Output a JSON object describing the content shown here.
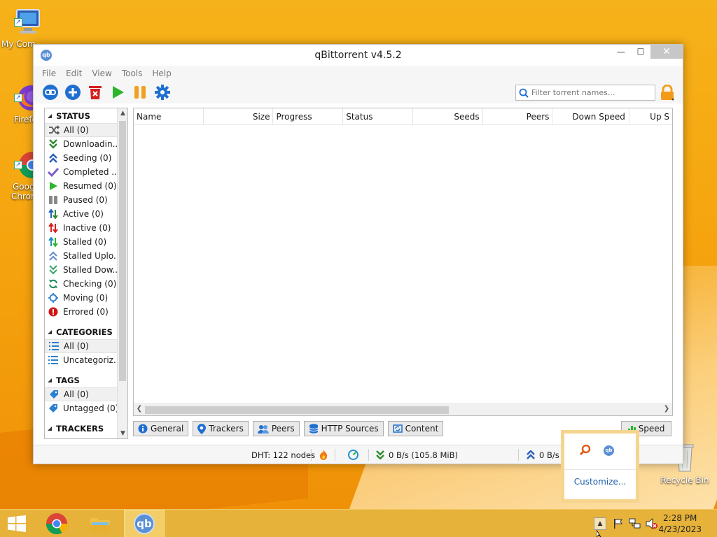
{
  "desktop": {
    "icons": [
      {
        "label": "My Com"
      },
      {
        "label": "Firefo"
      },
      {
        "label": "Goog"
      },
      {
        "label": "Chron"
      },
      {
        "label": "Recycle Bin"
      }
    ]
  },
  "window": {
    "title": "qBittorrent v4.5.2",
    "app_icon_text": "qb",
    "controls": {
      "minimize": "—",
      "maximize": "☐",
      "close": "✕"
    }
  },
  "menu": [
    "File",
    "Edit",
    "View",
    "Tools",
    "Help"
  ],
  "toolbar": {
    "search_placeholder": "Filter torrent names..."
  },
  "sidebar": {
    "status_header": "STATUS",
    "status_items": [
      {
        "label": "All (0)",
        "icon": "shuffle-icon",
        "color": "#555555"
      },
      {
        "label": "Downloadin...",
        "icon": "double-chevron-down-icon",
        "color": "#2e8b2e"
      },
      {
        "label": "Seeding (0)",
        "icon": "double-chevron-up-icon",
        "color": "#2a5fbf"
      },
      {
        "label": "Completed ...",
        "icon": "checkmark-icon",
        "color": "#7b5fc9"
      },
      {
        "label": "Resumed (0)",
        "icon": "play-icon",
        "color": "#2db52d"
      },
      {
        "label": "Paused (0)",
        "icon": "pause-icon",
        "color": "#888888"
      },
      {
        "label": "Active (0)",
        "icon": "up-down-arrows-icon",
        "color": "#2e8b2e"
      },
      {
        "label": "Inactive (0)",
        "icon": "up-down-arrows-red-icon",
        "color": "#d62020"
      },
      {
        "label": "Stalled (0)",
        "icon": "up-down-arrows-blue-icon",
        "color": "#1f8fbf"
      },
      {
        "label": "Stalled Uplo...",
        "icon": "double-chevron-up-light-icon",
        "color": "#6a8fd0"
      },
      {
        "label": "Stalled Dow...",
        "icon": "double-chevron-down-light-icon",
        "color": "#3fa86a"
      },
      {
        "label": "Checking (0)",
        "icon": "refresh-icon",
        "color": "#1a8a5a"
      },
      {
        "label": "Moving (0)",
        "icon": "move-target-icon",
        "color": "#2a7fd0"
      },
      {
        "label": "Errored (0)",
        "icon": "error-icon",
        "color": "#d41111"
      }
    ],
    "categories_header": "CATEGORIES",
    "category_items": [
      {
        "label": "All (0)"
      },
      {
        "label": "Uncategoriz..."
      }
    ],
    "tags_header": "TAGS",
    "tag_items": [
      {
        "label": "All (0)"
      },
      {
        "label": "Untagged (0)"
      }
    ],
    "trackers_header": "TRACKERS"
  },
  "table": {
    "columns": [
      "Name",
      "Size",
      "Progress",
      "Status",
      "Seeds",
      "Peers",
      "Down Speed",
      "Up S"
    ]
  },
  "tabs": [
    "General",
    "Trackers",
    "Peers",
    "HTTP Sources",
    "Content"
  ],
  "speed_button": "Speed",
  "statusbar": {
    "dht": "DHT: 122 nodes",
    "down": "0 B/s (105.8 MiB)",
    "up": "0 B/s ("
  },
  "tray_popup": {
    "customize": "Customize..."
  },
  "taskbar": {
    "time": "2:28 PM",
    "date": "4/23/2023",
    "qb_label": "qb"
  },
  "colors": {
    "accent_blue": "#1f6fd0",
    "play_green": "#2db52d",
    "pause_orange": "#f0a020",
    "delete_red": "#d42020"
  }
}
